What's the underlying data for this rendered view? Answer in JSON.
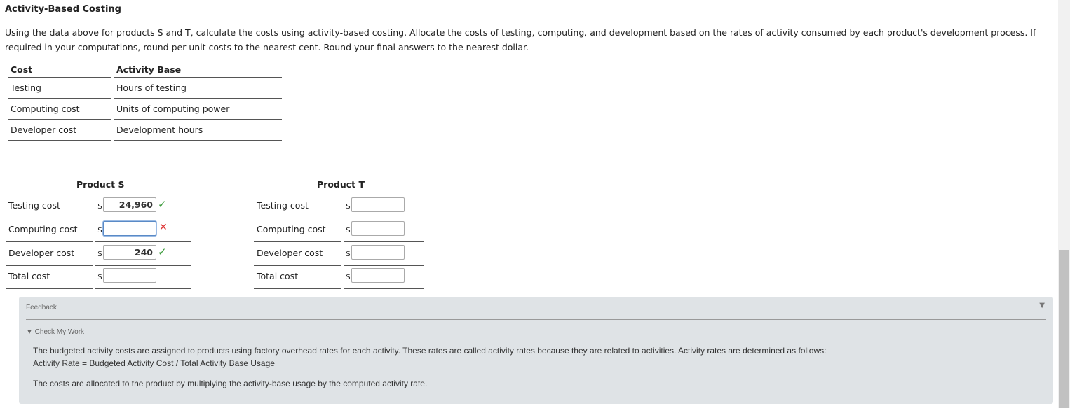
{
  "page": {
    "title": "Activity-Based Costing",
    "instructions": "Using the data above for products S and T, calculate the costs using activity-based costing. Allocate the costs of testing, computing, and development based on the rates of activity consumed by each product's development process. If required in your computations, round per unit costs to the nearest cent. Round your final answers to the nearest dollar."
  },
  "activity_table": {
    "headers": [
      "Cost",
      "Activity Base"
    ],
    "rows": [
      [
        "Testing",
        "Hours of testing"
      ],
      [
        "Computing cost",
        "Units of computing power"
      ],
      [
        "Developer cost",
        "Development hours"
      ]
    ]
  },
  "product_s": {
    "title": "Product S",
    "rows": [
      {
        "label": "Testing cost",
        "currency": "$",
        "value": "24,960",
        "status": "correct"
      },
      {
        "label": "Computing cost",
        "currency": "$",
        "value": "",
        "status": "incorrect"
      },
      {
        "label": "Developer cost",
        "currency": "$",
        "value": "240",
        "status": "correct"
      },
      {
        "label": "Total cost",
        "currency": "$",
        "value": "",
        "status": "none"
      }
    ]
  },
  "product_t": {
    "title": "Product T",
    "rows": [
      {
        "label": "Testing cost",
        "currency": "$",
        "value": ""
      },
      {
        "label": "Computing cost",
        "currency": "$",
        "value": ""
      },
      {
        "label": "Developer cost",
        "currency": "$",
        "value": ""
      },
      {
        "label": "Total cost",
        "currency": "$",
        "value": ""
      }
    ]
  },
  "feedback": {
    "label": "Feedback",
    "toggle_icon": "triangle-down-icon",
    "check_my_work": "▼ Check My Work",
    "para1_line1": "The budgeted activity costs are assigned to products using factory overhead rates for each activity. These rates are called activity rates because they are related to activities. Activity rates are determined as follows:",
    "para1_line2": "Activity Rate = Budgeted Activity Cost / Total Activity Base Usage",
    "para2": "The costs are allocated to the product by multiplying the activity-base usage by the computed activity rate."
  },
  "icons": {
    "correct": "checkmark-icon",
    "incorrect": "x-mark-icon"
  },
  "colors": {
    "correct": "#3a9a3a",
    "incorrect": "#dd3333",
    "feedback_bg": "#dfe3e6"
  }
}
